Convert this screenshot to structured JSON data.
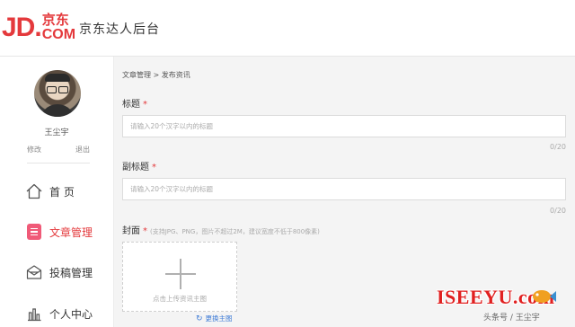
{
  "header": {
    "logo_jd": "JD.",
    "logo_cn": "京东",
    "logo_dotcom": "COM",
    "title": "京东达人后台"
  },
  "sidebar": {
    "username": "王尘宇",
    "edit_label": "修改",
    "logout_label": "退出",
    "items": [
      {
        "label": "首 页",
        "icon": "home-icon",
        "active": false
      },
      {
        "label": "文章管理",
        "icon": "article-icon",
        "active": true
      },
      {
        "label": "投稿管理",
        "icon": "inbox-icon",
        "active": false
      },
      {
        "label": "个人中心",
        "icon": "chart-icon",
        "active": false
      }
    ]
  },
  "main": {
    "breadcrumb": "文章管理 > 发布资讯",
    "title_field": {
      "label": "标题",
      "required_mark": "*",
      "placeholder": "请输入20个汉字以内的标题",
      "counter": "0/20"
    },
    "subtitle_field": {
      "label": "副标题",
      "required_mark": "*",
      "placeholder": "请输入20个汉字以内的标题",
      "counter": "0/20"
    },
    "cover_field": {
      "label": "封面",
      "required_mark": "*",
      "hint": "(支持JPG、PNG，图片不超过2M，建议宽度不低于800像素)",
      "upload_label": "点击上传资讯主图",
      "change_label": "更换主图"
    }
  },
  "watermark": {
    "brand": "ISEEYU.com",
    "sub": "头条号 / 王尘宇"
  },
  "colors": {
    "brand_red": "#e4393c",
    "active_badge": "#f05a78",
    "link_blue": "#3c7ad6"
  }
}
